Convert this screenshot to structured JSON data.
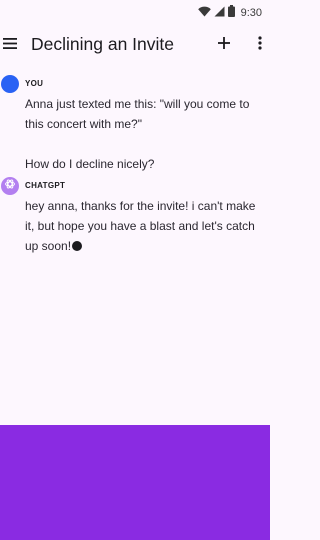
{
  "status_bar": {
    "time": "9:30",
    "icons": [
      "wifi-icon",
      "cellular-signal-icon",
      "battery-icon"
    ]
  },
  "app_bar": {
    "title": "Declining an Invite",
    "icons": [
      "menu-icon",
      "plus-icon",
      "more-vert-icon"
    ]
  },
  "conversation": {
    "messages": [
      {
        "sender": "YOU",
        "paragraphs": [
          "Anna just texted me this: \"will you come to this concert with me?\"",
          "How do I decline nicely?"
        ]
      },
      {
        "sender": "CHATGPT",
        "paragraphs": [
          "hey anna, thanks for the invite! i can't make it, but hope you have a blast and let's catch up soon!"
        ]
      }
    ]
  },
  "colors": {
    "background": "#fdf7fe",
    "user_avatar": "#2962f4",
    "bot_avatar": "#b37ff0",
    "bottom_panel": "#8a2be2"
  }
}
